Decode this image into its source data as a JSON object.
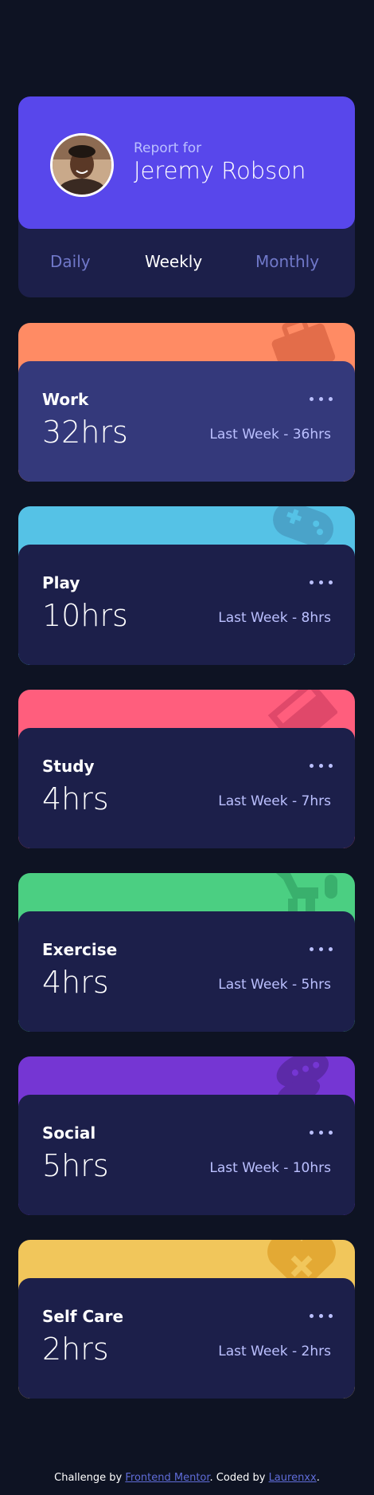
{
  "profile": {
    "report_label": "Report for",
    "name": "Jeremy Robson",
    "periods": [
      "Daily",
      "Weekly",
      "Monthly"
    ],
    "active_period": "Weekly"
  },
  "cards": [
    {
      "title": "Work",
      "hours": "32hrs",
      "last_week": "Last Week - 36hrs",
      "color": "#ff8b64",
      "icon": "briefcase-icon"
    },
    {
      "title": "Play",
      "hours": "10hrs",
      "last_week": "Last Week - 8hrs",
      "color": "#55c2e6",
      "icon": "gamepad-icon"
    },
    {
      "title": "Study",
      "hours": "4hrs",
      "last_week": "Last Week - 7hrs",
      "color": "#ff5e7d",
      "icon": "book-icon"
    },
    {
      "title": "Exercise",
      "hours": "4hrs",
      "last_week": "Last Week - 5hrs",
      "color": "#4bcf82",
      "icon": "running-icon"
    },
    {
      "title": "Social",
      "hours": "5hrs",
      "last_week": "Last Week - 10hrs",
      "color": "#7536d3",
      "icon": "social-icon"
    },
    {
      "title": "Self Care",
      "hours": "2hrs",
      "last_week": "Last Week - 2hrs",
      "color": "#f1c65b",
      "icon": "heart-icon"
    }
  ],
  "footer": {
    "prefix": "Challenge by ",
    "link1": "Frontend Mentor",
    "middle": ". Coded by ",
    "link2": "Laurenxx",
    "suffix": "."
  }
}
